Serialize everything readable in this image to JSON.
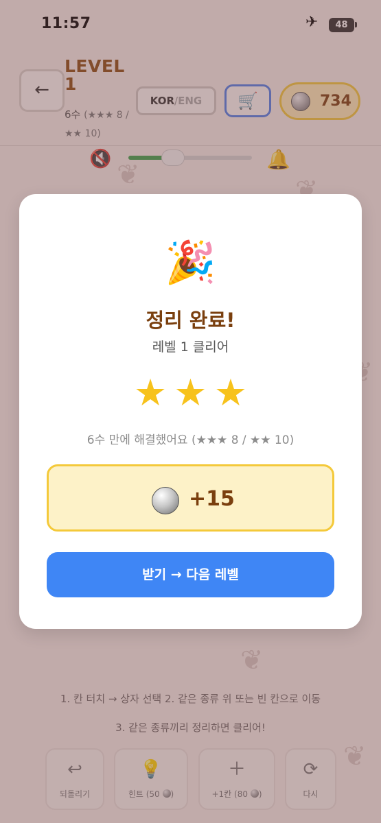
{
  "status_bar": {
    "time": "11:57",
    "airplane_icon": "airplane-icon",
    "battery": "48"
  },
  "header": {
    "back_label": "←",
    "level_title": "LEVEL 1",
    "moves_main": "6수",
    "moves_detail": "(★★★ 8 / ★★ 10)",
    "lang_kor": "KOR",
    "lang_sep": "/",
    "lang_eng": "ENG",
    "cart_icon": "shopping-cart-icon",
    "coins": "734"
  },
  "sound": {
    "mute_icon": "speaker-mute-icon",
    "volume_level": 0.36,
    "bell_icon": "bell-icon"
  },
  "rules": {
    "line1": "1. 칸 터치 → 상자 선택   2. 같은 종류 위 또는 빈 칸으로 이동",
    "line2": "3. 같은 종류끼리 정리하면 클리어!"
  },
  "bottom_buttons": [
    {
      "label": "되돌리기",
      "icon": "undo-icon"
    },
    {
      "label": "힌트 (50",
      "icon": "lightbulb-icon"
    },
    {
      "label": "+1칸 (80",
      "icon": "plus-icon"
    },
    {
      "label": "다시",
      "icon": "refresh-icon"
    }
  ],
  "modal": {
    "icon": "party-popper-icon",
    "title": "정리 완료!",
    "subtitle": "레벨 1 클리어",
    "stars_earned": 3,
    "moves_line": "6수 만에 해결했어요 (★★★ 8 / ★★ 10)",
    "reward_amount": "+15",
    "claim_label": "받기 → 다음 레벨"
  },
  "colors": {
    "accent_blue": "#3f86f5",
    "star_gold": "#f7c21c",
    "title_brown": "#7a3f0e",
    "reward_bg": "#fdf2c8"
  }
}
